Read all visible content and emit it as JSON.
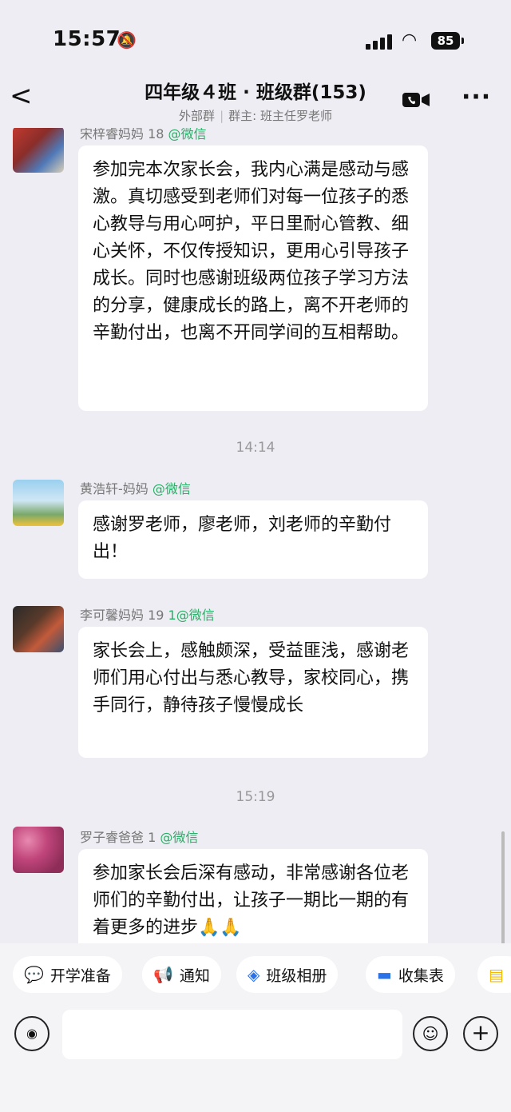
{
  "status": {
    "time": "15:57",
    "battery": "85"
  },
  "header": {
    "back": "<",
    "title": "四年级４班 · 班级群(153)",
    "subtitle_left": "外部群",
    "subtitle_right": "群主: 班主任罗老师",
    "more": "···"
  },
  "messages": [
    {
      "sender": "宋梓睿妈妈 18",
      "sender_tag": "@微信",
      "text": "参加完本次家长会，我内心满是感动与感激。真切感受到老师们对每一位孩子的悉心教导与用心呵护，平日里耐心管教、细心关怀，不仅传授知识，更用心引导孩子成长。同时也感谢班级两位孩子学习方法的分享，健康成长的路上，离不开老师的辛勤付出，也离不开同学间的互相帮助。"
    },
    {
      "sender": "黄浩轩-妈妈",
      "sender_tag": "@微信",
      "text": "感谢罗老师，廖老师，刘老师的辛勤付出！"
    },
    {
      "sender": "李可馨妈妈 19",
      "sender_tag": "1@微信",
      "text": "家长会上，感触颇深，受益匪浅，感谢老师们用心付出与悉心教导，家校同心，携手同行，静待孩子慢慢成长"
    },
    {
      "sender": "罗子睿爸爸 1",
      "sender_tag": "@微信",
      "text": "参加家长会后深有感动，非常感谢各位老师们的辛勤付出，让孩子一期比一期的有着更多的进步🙏🙏"
    }
  ],
  "timestamps": [
    "14:14",
    "15:19"
  ],
  "toolbar": [
    {
      "icon": "💬",
      "label": "开学准备",
      "color": "#2bbfb3"
    },
    {
      "icon": "📢",
      "label": "通知",
      "color": "#f5a623"
    },
    {
      "icon": "◈",
      "label": "班级相册",
      "color": "#2a72e8"
    },
    {
      "icon": "▬",
      "label": "收集表",
      "color": "#2a72e8"
    }
  ],
  "input": {
    "placeholder": ""
  }
}
